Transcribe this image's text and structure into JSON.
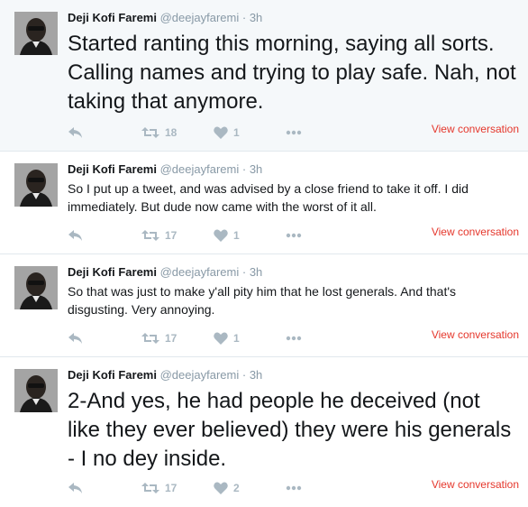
{
  "colors": {
    "accent": "#e5372c",
    "muted": "#8899a6",
    "icon": "#aab8c2",
    "highlight_bg": "#f5f8fa"
  },
  "tweets": [
    {
      "name": "Deji Kofi Faremi",
      "handle": "@deejayfaremi",
      "dot": "·",
      "time": "3h",
      "text": "Started ranting this morning, saying all sorts. Calling names and trying to play safe. Nah, not taking that anymore.",
      "retweets": "18",
      "likes": "1",
      "view_conversation": "View conversation"
    },
    {
      "name": "Deji Kofi Faremi",
      "handle": "@deejayfaremi",
      "dot": "·",
      "time": "3h",
      "text": "So I put up a tweet, and was advised by a close friend to take it off. I did immediately. But dude now came with the worst of it all.",
      "retweets": "17",
      "likes": "1",
      "view_conversation": "View conversation"
    },
    {
      "name": "Deji Kofi Faremi",
      "handle": "@deejayfaremi",
      "dot": "·",
      "time": "3h",
      "text": "So that was just to make y'all pity him that he lost generals. And that's disgusting. Very annoying.",
      "retweets": "17",
      "likes": "1",
      "view_conversation": "View conversation"
    },
    {
      "name": "Deji Kofi Faremi",
      "handle": "@deejayfaremi",
      "dot": "·",
      "time": "3h",
      "text": "2-And yes, he had people he deceived (not like they ever believed) they were his generals - I no dey inside.",
      "retweets": "17",
      "likes": "2",
      "view_conversation": "View conversation"
    }
  ]
}
